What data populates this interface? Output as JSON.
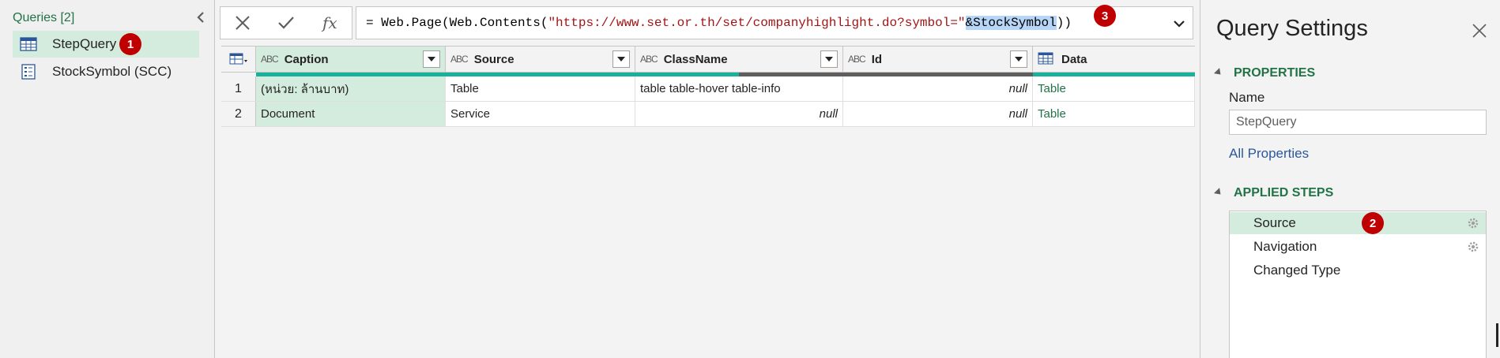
{
  "queries": {
    "header": "Queries [2]",
    "items": [
      {
        "label": "StepQuery",
        "icon": "table-icon",
        "badge": "1"
      },
      {
        "label": "StockSymbol (SCC)",
        "icon": "parameter-icon"
      }
    ]
  },
  "formula": {
    "prefix": "= Web.Page(Web.Contents(",
    "url": "\"https://www.set.or.th/set/companyhighlight.do?symbol=\"",
    "selected": "&StockSymbol",
    "suffix": "))",
    "badge": "3",
    "fx": "fx"
  },
  "grid": {
    "columns": [
      {
        "type": "ABC",
        "label": "Caption"
      },
      {
        "type": "ABC",
        "label": "Source"
      },
      {
        "type": "ABC",
        "label": "ClassName"
      },
      {
        "type": "ABC",
        "label": "Id"
      },
      {
        "type": "table",
        "label": "Data"
      }
    ],
    "rows": [
      {
        "num": "1",
        "cells": [
          "(หน่วย: ล้านบาท)",
          "Table",
          "table table-hover table-info",
          "null",
          "Table"
        ]
      },
      {
        "num": "2",
        "cells": [
          "Document",
          "Service",
          "null",
          "null",
          "Table"
        ]
      }
    ]
  },
  "settings": {
    "title": "Query Settings",
    "properties_head": "PROPERTIES",
    "name_label": "Name",
    "name_value": "StepQuery",
    "all_properties": "All Properties",
    "steps_head": "APPLIED STEPS",
    "steps": [
      {
        "label": "Source",
        "badge": "2",
        "gear": true
      },
      {
        "label": "Navigation",
        "gear": true
      },
      {
        "label": "Changed Type",
        "gear": false
      }
    ]
  },
  "colors": {
    "accent": "#217346",
    "selected_bg": "#d3ecde",
    "badge": "#c00000",
    "quality_valid": "#18b19b",
    "quality_empty": "#605e5c"
  }
}
